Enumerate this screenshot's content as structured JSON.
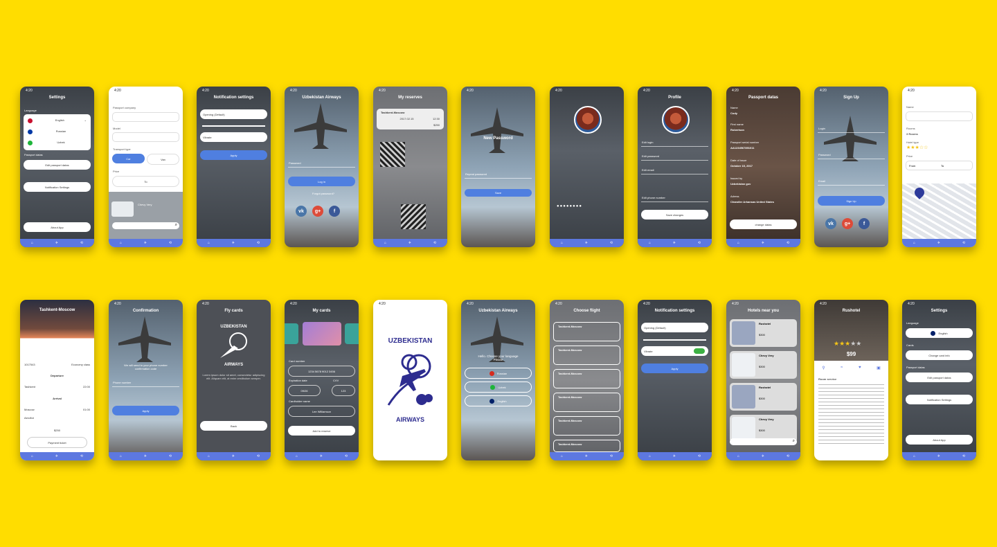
{
  "status_time": "4:20",
  "tabs": {
    "home": "⌂",
    "flights": "✈",
    "settings": "⟲"
  },
  "screens": {
    "settings": {
      "title": "Settings",
      "language": "Language",
      "langs": [
        "English",
        "Russian",
        "Uzbek"
      ],
      "passport": "Passport datas",
      "edit": "Edit passport datas",
      "notif": "Notification Settings",
      "about": "About App"
    },
    "form": {
      "company": "Passport company",
      "model": "Model",
      "transport": "Transport type",
      "car": "Car",
      "van": "Van",
      "price": "Price",
      "to": "To",
      "car_name": "Chevy Very"
    },
    "notification": {
      "title": "Notification settings",
      "opening": "Opening (Default)",
      "vibrate": "Vibrate",
      "apply": "Apply"
    },
    "login": {
      "title": "Uzbekistan Airways",
      "password": "Password",
      "login": "Log in",
      "forgot": "Forgot password?"
    },
    "reserves": {
      "title": "My reserves",
      "route": "Tashkent-Moscow",
      "date": "2017.02.15",
      "time": "12:30",
      "price": "$250"
    },
    "newpass": {
      "title": "New Password",
      "repeat": "Repeat password",
      "save": "Save"
    },
    "profile": {
      "title": "Profile",
      "login": "Edit login",
      "pass": "Edit password",
      "email": "Edit email",
      "phone": "Edit phone number",
      "save": "Save changes"
    },
    "passport": {
      "title": "Passport datas",
      "name": "Name",
      "name_v": "Cody",
      "first": "First name",
      "first_v": "Robertson",
      "serial": "Passport serial number",
      "serial_v": "AA1234567891011",
      "issue": "Date of issue",
      "issue_v": "October 15, 2017",
      "issued": "Issued by",
      "issued_v": "Uzbekistan gov",
      "address": "Adress",
      "address_v": "Chandler Arkansas United States",
      "change": "change datas"
    },
    "signup": {
      "title": "Sign Up",
      "login": "Login",
      "pass": "Password",
      "repeat": "Repeat password",
      "email": "Email",
      "button": "Sign Up"
    },
    "filter": {
      "name": "Name",
      "rooms": "Rooms",
      "rooms_v": "3 Rooms",
      "hotel": "Hotel type",
      "price": "Price",
      "from": "From",
      "to": "To"
    },
    "ticket": {
      "title": "Tashkent-Moscow",
      "flight": "1017543",
      "class": "Economy class",
      "departure": "Departure",
      "dep_city": "Tashkent",
      "dep_time": "22:00",
      "arrival": "Arrival",
      "arr_city": "Moscow",
      "arr_time": "01:00",
      "airport": "Aeroflot",
      "price": "$250",
      "pay": "Payment ticket"
    },
    "confirm": {
      "title": "Confirmation",
      "msg": "We will send to your phone number confirmation code",
      "code": "Phone number",
      "apply": "Apply"
    },
    "flycards": {
      "title": "Fly cards",
      "brand": "UZBEKISTAN",
      "brand2": "AIRWAYS",
      "text": "Lorem ipsum dolor sit amet, consectetur adipiscing elit. Aliquam elit, at enim vestibulum semper.",
      "back": "Back"
    },
    "mycards": {
      "title": "My cards",
      "card_number": "Card number",
      "card_v": "1234 5678 9012 3456",
      "exp": "Expiration date",
      "exp_v": "09/26",
      "cvv": "CVV",
      "cvv_v": "123",
      "holder": "Cardholder name",
      "holder_v": "Lee Williamson",
      "add": "Add to reserve"
    },
    "splash": {
      "top": "UZBEKISTAN",
      "bottom": "AIRWAYS"
    },
    "language": {
      "title": "Uzbekistan Airways",
      "msg": "Hello. Choose your language Please",
      "langs": [
        "Russian",
        "Uzbek",
        "English"
      ]
    },
    "choose": {
      "title": "Choose flight",
      "route": "Tashkent-Moscow"
    },
    "notification2": {
      "title": "Notification settings",
      "opening": "Opening (Default)",
      "vibrate": "Vibrate",
      "apply": "Apply"
    },
    "hotels": {
      "title": "Hotels near you",
      "names": [
        "Rushotel",
        "Chevy Very",
        "Rushotel",
        "Chevy Very"
      ],
      "price": "$300"
    },
    "rushotel": {
      "title": "Rushotel",
      "price": "$99",
      "room": "Room service"
    },
    "settings2": {
      "title": "Settings",
      "language": "Language",
      "lang_v": "English",
      "cards": "Cards",
      "change_card": "Change card info",
      "passport": "Passport datas",
      "edit": "Edit passport datas",
      "notif": "Notification Settings",
      "about": "About App"
    }
  }
}
